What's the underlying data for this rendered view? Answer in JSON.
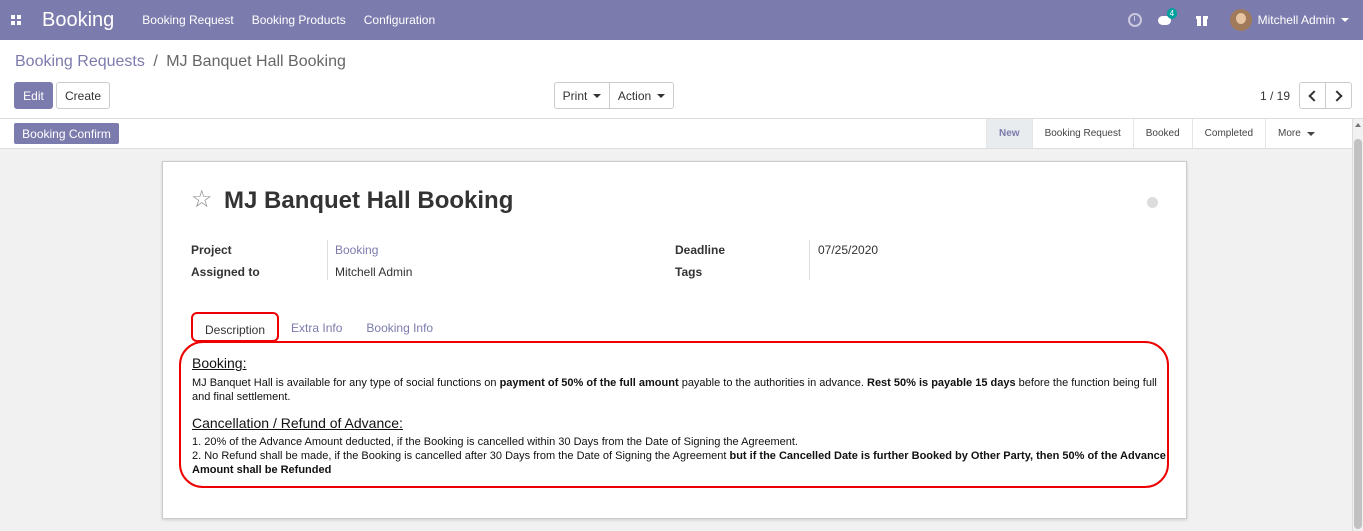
{
  "navbar": {
    "app_title": "Booking",
    "menu": [
      "Booking Request",
      "Booking Products",
      "Configuration"
    ],
    "chat_count": "4",
    "user_name": "Mitchell Admin"
  },
  "breadcrumb": {
    "parent": "Booking Requests",
    "separator": "/",
    "current": "MJ Banquet Hall Booking"
  },
  "buttons": {
    "edit": "Edit",
    "create": "Create",
    "print": "Print",
    "action": "Action",
    "booking_confirm": "Booking Confirm"
  },
  "pager": {
    "value": "1 / 19"
  },
  "stages": [
    "New",
    "Booking Request",
    "Booked",
    "Completed",
    "More"
  ],
  "record": {
    "title": "MJ Banquet Hall Booking",
    "fields": {
      "project_label": "Project",
      "project_value": "Booking",
      "assigned_label": "Assigned to",
      "assigned_value": "Mitchell Admin",
      "deadline_label": "Deadline",
      "deadline_value": "07/25/2020",
      "tags_label": "Tags"
    },
    "tabs": [
      "Description",
      "Extra Info",
      "Booking Info"
    ],
    "description": {
      "heading1": "Booking:",
      "para1_a": "MJ Banquet Hall is available for any type of social functions on ",
      "para1_b": "payment of 50% of the full amount",
      "para1_c": " payable to the authorities in advance. ",
      "para1_d": "Rest 50% is payable 15 days",
      "para1_e": " before the function being full",
      "para1_f": "and final settlement.",
      "heading2": "Cancellation / Refund of Advance:",
      "item1": "1. 20% of the Advance Amount deducted, if the Booking is cancelled within 30 Days from the Date of Signing the Agreement.",
      "item2_a": "2. No Refund shall be made, if the Booking is cancelled after 30 Days from the Date of Signing the Agreement ",
      "item2_b": "but if the Cancelled Date is further Booked by Other Party, then 50% of the Advance",
      "item2_c": "Amount shall be Refunded"
    }
  },
  "colors": {
    "brand": "#7c7bad",
    "highlight": "#e00000"
  }
}
